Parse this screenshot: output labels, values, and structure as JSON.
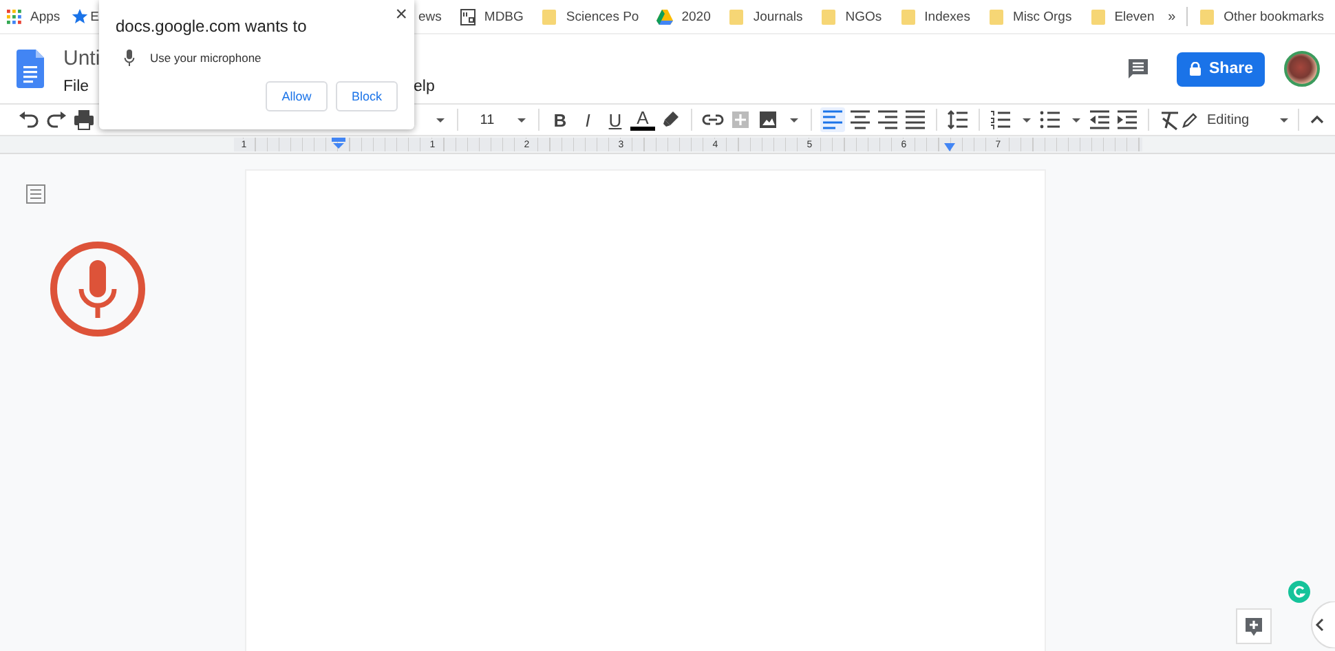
{
  "bookmarks_bar": {
    "left": [
      {
        "kind": "apps",
        "label": "Apps"
      },
      {
        "kind": "star",
        "label": "E"
      }
    ],
    "right": [
      {
        "kind": "plain",
        "label": "ews"
      },
      {
        "kind": "mdbg",
        "label": "MDBG"
      },
      {
        "kind": "folder",
        "label": "Sciences Po"
      },
      {
        "kind": "drive",
        "label": "2020"
      },
      {
        "kind": "folder",
        "label": "Journals"
      },
      {
        "kind": "folder",
        "label": "NGOs"
      },
      {
        "kind": "folder",
        "label": "Indexes"
      },
      {
        "kind": "folder",
        "label": "Misc Orgs"
      },
      {
        "kind": "folder",
        "label": "Eleven"
      }
    ],
    "overflow": "»",
    "other": {
      "kind": "folder",
      "label": "Other bookmarks"
    }
  },
  "document": {
    "title": "Unti",
    "menu": [
      "File",
      "elp"
    ]
  },
  "share": {
    "label": "Share"
  },
  "toolbar": {
    "left": [
      {
        "kind": "undo"
      },
      {
        "kind": "redo"
      },
      {
        "kind": "print"
      }
    ],
    "right": [
      {
        "kind": "caret"
      },
      {
        "kind": "divider"
      },
      {
        "kind": "text",
        "label": "11"
      },
      {
        "kind": "caret"
      },
      {
        "kind": "divider"
      },
      {
        "kind": "bold",
        "label": "B"
      },
      {
        "kind": "italic",
        "label": "I"
      },
      {
        "kind": "underline",
        "label": "U"
      },
      {
        "kind": "textcolor",
        "label": "A"
      },
      {
        "kind": "highlight"
      },
      {
        "kind": "divider"
      },
      {
        "kind": "link"
      },
      {
        "kind": "comment"
      },
      {
        "kind": "image"
      },
      {
        "kind": "caret"
      },
      {
        "kind": "divider"
      },
      {
        "kind": "align",
        "selected": true
      },
      {
        "kind": "align",
        "selected": false
      },
      {
        "kind": "align",
        "selected": false
      },
      {
        "kind": "align",
        "selected": false
      },
      {
        "kind": "divider"
      },
      {
        "kind": "spacing"
      },
      {
        "kind": "divider"
      },
      {
        "kind": "numbered"
      },
      {
        "kind": "caret"
      },
      {
        "kind": "bulleted"
      },
      {
        "kind": "caret"
      },
      {
        "kind": "outdent"
      },
      {
        "kind": "indent"
      },
      {
        "kind": "divider"
      },
      {
        "kind": "clear"
      }
    ],
    "mode": "Editing"
  },
  "ruler": {
    "labels": [
      "1",
      "1",
      "2",
      "3",
      "4",
      "5",
      "6",
      "7"
    ]
  },
  "permission_popup": {
    "title": "docs.google.com wants to",
    "request": "Use your microphone",
    "buttons": [
      "Allow",
      "Block"
    ],
    "close": "×"
  }
}
